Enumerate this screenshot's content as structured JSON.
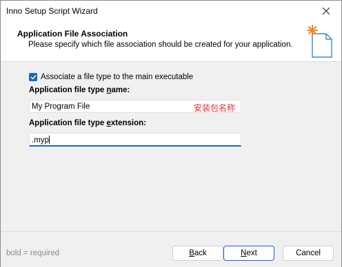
{
  "window": {
    "title": "Inno Setup Script Wizard"
  },
  "header": {
    "title": "Application File Association",
    "subtitle": "Please specify which file association should be created for your application."
  },
  "form": {
    "checkbox_label": "Associate a file type to the main executable",
    "checkbox_checked": true,
    "name_label_pre": "Application file type ",
    "name_label_u": "n",
    "name_label_post": "ame:",
    "name_value": "My Program File",
    "name_note": "安装包名称",
    "ext_label_pre": "Application file type ",
    "ext_label_u": "e",
    "ext_label_post": "xtension:",
    "ext_value": ".myp"
  },
  "footer": {
    "legend": "bold = required",
    "back_u": "B",
    "back_rest": "ack",
    "next_u": "N",
    "next_rest": "ext",
    "cancel": "Cancel"
  },
  "colors": {
    "accent": "#1866c8",
    "note": "#e03030"
  },
  "icons": [
    "close-icon",
    "checkmark-icon",
    "wizard-document-icon"
  ]
}
